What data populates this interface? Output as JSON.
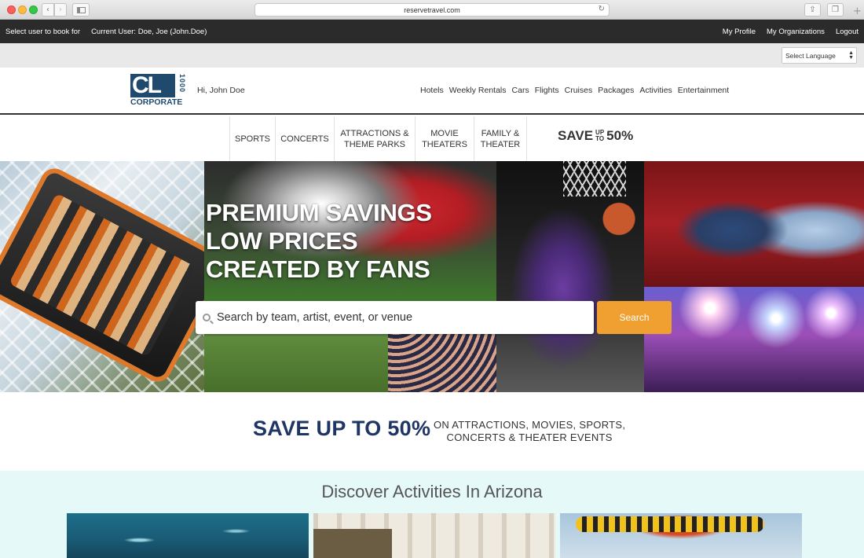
{
  "browser": {
    "url": "reservetravel.com"
  },
  "topbar": {
    "select_user": "Select user to book for",
    "current_user": "Current User: Doe, Joe (John.Doe)",
    "my_profile": "My Profile",
    "my_organizations": "My Organizations",
    "logout": "Logout"
  },
  "language": {
    "selected": "Select Language"
  },
  "header": {
    "logo_letters": "CL",
    "logo_side": "1000",
    "logo_corporate": "CORPORATE",
    "greeting": "Hi, John Doe",
    "nav": [
      "Hotels",
      "Weekly Rentals",
      "Cars",
      "Flights",
      "Cruises",
      "Packages",
      "Activities",
      "Entertainment"
    ]
  },
  "subnav": {
    "items": [
      "SPORTS",
      "CONCERTS",
      "ATTRACTIONS &\nTHEME PARKS",
      "MOVIE\nTHEATERS",
      "FAMILY &\nTHEATER"
    ],
    "save_text": "SAVE",
    "save_up": "UP",
    "save_to": "TO",
    "save_percent": "50%"
  },
  "hero": {
    "title_lines": [
      "PREMIUM SAVINGS",
      "LOW PRICES",
      "CREATED BY FANS"
    ],
    "search_placeholder": "Search by team, artist, event, or venue",
    "search_button": "Search"
  },
  "promo": {
    "big": "SAVE UP TO 50%",
    "small_line1": "ON ATTRACTIONS, MOVIES, SPORTS,",
    "small_line2": "CONCERTS & THEATER EVENTS"
  },
  "discover": {
    "title": "Discover Activities In Arizona"
  },
  "colors": {
    "topbar": "#2b2b2b",
    "brand_navy": "#1f3564",
    "logo_blue": "#1f4a6e",
    "search_button": "#f0a030",
    "discover_bg": "#e6f9f9"
  }
}
